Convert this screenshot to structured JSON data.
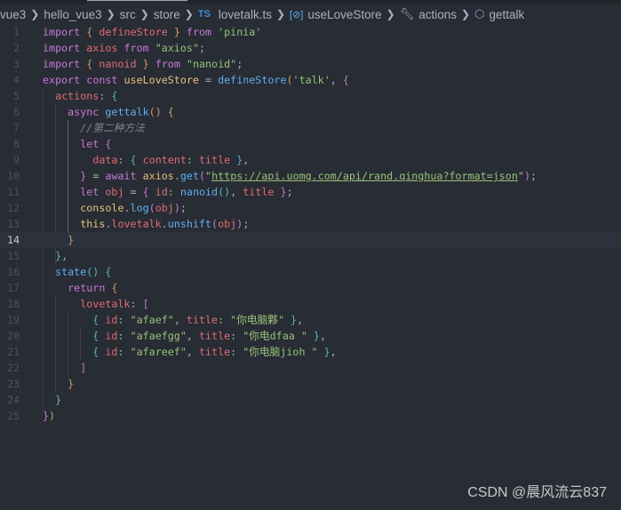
{
  "breadcrumb": {
    "items": [
      {
        "label": "vue3",
        "icon": null
      },
      {
        "label": "hello_vue3",
        "icon": null
      },
      {
        "label": "src",
        "icon": null
      },
      {
        "label": "store",
        "icon": null
      },
      {
        "label": "lovetalk.ts",
        "icon": "TS"
      },
      {
        "label": "useLoveStore",
        "icon": "variable-icon"
      },
      {
        "label": "actions",
        "icon": "wrench-icon"
      },
      {
        "label": "gettalk",
        "icon": "cube-icon"
      }
    ]
  },
  "editor": {
    "current_line": 14,
    "lines": [
      [
        [
          "import",
          "kw"
        ],
        [
          " ",
          "p"
        ],
        [
          "{",
          "b1"
        ],
        [
          " defineStore ",
          "var"
        ],
        [
          "}",
          "b1"
        ],
        [
          " ",
          "p"
        ],
        [
          "from",
          "kw"
        ],
        [
          " 'pinia'",
          "str"
        ]
      ],
      [
        [
          "import",
          "kw"
        ],
        [
          " axios ",
          "var"
        ],
        [
          "from",
          "kw"
        ],
        [
          " \"axios\"",
          "str"
        ],
        [
          ";",
          "p"
        ]
      ],
      [
        [
          "import",
          "kw"
        ],
        [
          " ",
          "p"
        ],
        [
          "{",
          "b1"
        ],
        [
          " nanoid ",
          "var"
        ],
        [
          "}",
          "b1"
        ],
        [
          " ",
          "p"
        ],
        [
          "from",
          "kw"
        ],
        [
          " \"nanoid\"",
          "str"
        ],
        [
          ";",
          "p"
        ]
      ],
      [
        [
          "export",
          "kw"
        ],
        [
          " ",
          "p"
        ],
        [
          "const",
          "kw"
        ],
        [
          " useLoveStore",
          "yl"
        ],
        [
          " = ",
          "p"
        ],
        [
          "defineStore",
          "fn"
        ],
        [
          "(",
          "b1"
        ],
        [
          "'talk'",
          "str"
        ],
        [
          ", ",
          "p"
        ],
        [
          "{",
          "b2"
        ]
      ],
      [
        [
          "  actions",
          "var"
        ],
        [
          ": ",
          "p"
        ],
        [
          "{",
          "b3"
        ]
      ],
      [
        [
          "    async",
          "kw"
        ],
        [
          " ",
          "p"
        ],
        [
          "gettalk",
          "fn"
        ],
        [
          "()",
          "b1"
        ],
        [
          " ",
          "p"
        ],
        [
          "{",
          "b1"
        ]
      ],
      [
        [
          "      //第二种方法",
          "cm"
        ]
      ],
      [
        [
          "      let",
          "kw"
        ],
        [
          " ",
          "p"
        ],
        [
          "{",
          "b2"
        ]
      ],
      [
        [
          "        data",
          "var"
        ],
        [
          ": ",
          "p"
        ],
        [
          "{",
          "b3"
        ],
        [
          " content",
          "var"
        ],
        [
          ": ",
          "p"
        ],
        [
          "title",
          "var"
        ],
        [
          " ",
          "p"
        ],
        [
          "}",
          "b3"
        ],
        [
          ",",
          "p"
        ]
      ],
      [
        [
          "      ",
          "p"
        ],
        [
          "}",
          "b2"
        ],
        [
          " = ",
          "p"
        ],
        [
          "await",
          "kw"
        ],
        [
          " axios",
          "yl"
        ],
        [
          ".",
          "p"
        ],
        [
          "get",
          "fn"
        ],
        [
          "(",
          "b2"
        ],
        [
          "\"",
          "str"
        ],
        [
          "https://api.uomg.com/api/rand.qinghua?format=json",
          "str url"
        ],
        [
          "\"",
          "str"
        ],
        [
          ")",
          "b2"
        ],
        [
          ";",
          "p"
        ]
      ],
      [
        [
          "      let",
          "kw"
        ],
        [
          " obj",
          "var"
        ],
        [
          " = ",
          "p"
        ],
        [
          "{",
          "b2"
        ],
        [
          " id",
          "var"
        ],
        [
          ": ",
          "p"
        ],
        [
          "nanoid",
          "fn"
        ],
        [
          "()",
          "b3"
        ],
        [
          ", ",
          "p"
        ],
        [
          "title",
          "var"
        ],
        [
          " ",
          "p"
        ],
        [
          "}",
          "b2"
        ],
        [
          ";",
          "p"
        ]
      ],
      [
        [
          "      console",
          "yl"
        ],
        [
          ".",
          "p"
        ],
        [
          "log",
          "fn"
        ],
        [
          "(",
          "b2"
        ],
        [
          "obj",
          "var"
        ],
        [
          ")",
          "b2"
        ],
        [
          ";",
          "p"
        ]
      ],
      [
        [
          "      this",
          "yl"
        ],
        [
          ".",
          "p"
        ],
        [
          "lovetalk",
          "var"
        ],
        [
          ".",
          "p"
        ],
        [
          "unshift",
          "fn"
        ],
        [
          "(",
          "b2"
        ],
        [
          "obj",
          "var"
        ],
        [
          ")",
          "b2"
        ],
        [
          ";",
          "p"
        ]
      ],
      [
        [
          "    ",
          "p"
        ],
        [
          "}",
          "b1"
        ]
      ],
      [
        [
          "  ",
          "p"
        ],
        [
          "}",
          "b3"
        ],
        [
          ",",
          "p"
        ]
      ],
      [
        [
          "  state",
          "fn"
        ],
        [
          "()",
          "b3"
        ],
        [
          " ",
          "p"
        ],
        [
          "{",
          "b3"
        ]
      ],
      [
        [
          "    return",
          "kw"
        ],
        [
          " ",
          "p"
        ],
        [
          "{",
          "b1"
        ]
      ],
      [
        [
          "      lovetalk",
          "var"
        ],
        [
          ": ",
          "p"
        ],
        [
          "[",
          "b2"
        ]
      ],
      [
        [
          "        ",
          "p"
        ],
        [
          "{",
          "b3"
        ],
        [
          " id",
          "var"
        ],
        [
          ": ",
          "p"
        ],
        [
          "\"afaef\"",
          "str"
        ],
        [
          ", ",
          "p"
        ],
        [
          "title",
          "var"
        ],
        [
          ": ",
          "p"
        ],
        [
          "\"你电脑夥\"",
          "str"
        ],
        [
          " ",
          "p"
        ],
        [
          "}",
          "b3"
        ],
        [
          ",",
          "p"
        ]
      ],
      [
        [
          "        ",
          "p"
        ],
        [
          "{",
          "b3"
        ],
        [
          " id",
          "var"
        ],
        [
          ": ",
          "p"
        ],
        [
          "\"afaefgg\"",
          "str"
        ],
        [
          ", ",
          "p"
        ],
        [
          "title",
          "var"
        ],
        [
          ": ",
          "p"
        ],
        [
          "\"你电dfaa \"",
          "str"
        ],
        [
          " ",
          "p"
        ],
        [
          "}",
          "b3"
        ],
        [
          ",",
          "p"
        ]
      ],
      [
        [
          "        ",
          "p"
        ],
        [
          "{",
          "b3"
        ],
        [
          " id",
          "var"
        ],
        [
          ": ",
          "p"
        ],
        [
          "\"afareef\"",
          "str"
        ],
        [
          ", ",
          "p"
        ],
        [
          "title",
          "var"
        ],
        [
          ": ",
          "p"
        ],
        [
          "\"你电脑jioh \"",
          "str"
        ],
        [
          " ",
          "p"
        ],
        [
          "}",
          "b3"
        ],
        [
          ",",
          "p"
        ]
      ],
      [
        [
          "      ",
          "p"
        ],
        [
          "]",
          "b2"
        ]
      ],
      [
        [
          "    ",
          "p"
        ],
        [
          "}",
          "b1"
        ]
      ],
      [
        [
          "  ",
          "p"
        ],
        [
          "}",
          "b3"
        ]
      ],
      [
        [
          "}",
          "b2"
        ],
        [
          ")",
          "b1"
        ]
      ]
    ]
  },
  "watermark": "CSDN @晨风流云837"
}
